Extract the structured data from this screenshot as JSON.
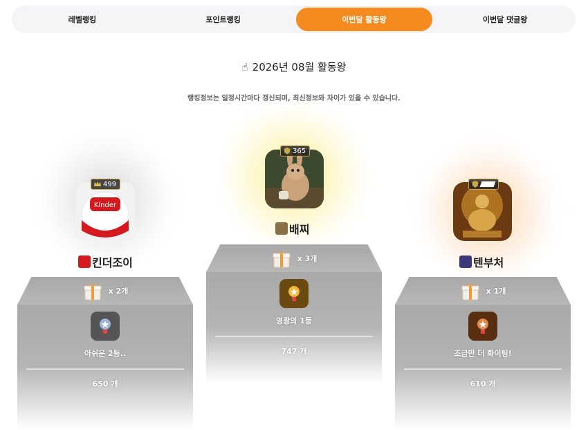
{
  "tabs": [
    {
      "label": "레벨랭킹",
      "active": false
    },
    {
      "label": "포인트랭킹",
      "active": false
    },
    {
      "label": "이번달 활동왕",
      "active": true
    },
    {
      "label": "이번달 댓글왕",
      "active": false
    }
  ],
  "title": "2026년 08월 활동왕",
  "title_icon": "pointing-hand-icon",
  "notice": "랭킹정보는 일정시간마다 갱신되며, 최신정보와 차이가 있을 수 있습니다.",
  "colors": {
    "accent": "#f58a1f",
    "podium": "#aaaaaa",
    "gold_glow": "#ffec78",
    "silver_glow": "#c8c8c8",
    "bronze_glow": "#ffc896"
  },
  "ranking": {
    "first": {
      "level": "365",
      "name": "배찌",
      "gift_count": "x 3개",
      "message": "영광의 1등",
      "score": "747 개",
      "medal": "gold-medal-icon"
    },
    "second": {
      "level": "499",
      "name": "킨더조이",
      "gift_count": "x 2개",
      "message": "아쉬운 2등..",
      "score": "650 개",
      "medal": "silver-medal-icon"
    },
    "third": {
      "level": "",
      "name": "텐부처",
      "gift_count": "x 1개",
      "message": "조금만 더 화이팅!",
      "score": "610 개",
      "medal": "bronze-medal-icon"
    }
  }
}
